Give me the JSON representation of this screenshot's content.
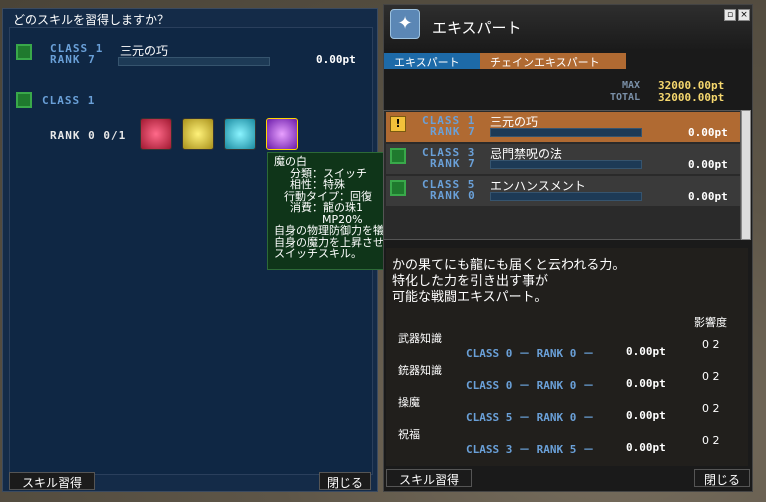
{
  "left": {
    "title": "どのスキルを習得しますか？",
    "top_row": {
      "class": "CLASS  1",
      "rank": "RANK  7",
      "skill": "三元の巧",
      "points": "0.00pt"
    },
    "class_header": "CLASS  1",
    "rank_line": "RANK  0  0/1",
    "buttons": {
      "learn": "スキル習得",
      "close": "閉じる"
    }
  },
  "tooltip": {
    "lines": [
      "魔の白",
      "分類：スイッチ",
      "相性：特殊",
      "行動タイプ：回復",
      "消費：龍の珠1",
      "MP20%",
      "自身の物理防御力を犠牲にして、",
      "自身の魔力を上昇させる",
      "スイッチスキル。"
    ]
  },
  "right": {
    "title": "エキスパート",
    "tabs": [
      "エキスパート",
      "チェインエキスパート"
    ],
    "max_label": "MAX",
    "max_value": "32000.00pt",
    "total_label": "TOTAL",
    "total_value": "32000.00pt",
    "list": [
      {
        "class": "CLASS  1",
        "rank": "RANK  7",
        "name": "三元の巧",
        "points": "0.00pt"
      },
      {
        "class": "CLASS  3",
        "rank": "RANK  7",
        "name": "忌門禁呪の法",
        "points": "0.00pt"
      },
      {
        "class": "CLASS  5",
        "rank": "RANK  0",
        "name": "エンハンスメント",
        "points": "0.00pt"
      }
    ],
    "description": [
      "かの果てにも龍にも届くと云われる力。",
      "特化した力を引き出す事が",
      "可能な戦闘エキスパート。"
    ],
    "influence_header": "影響度",
    "influences": [
      {
        "label": "武器知識",
        "class": "CLASS 0 － RANK 0 －",
        "points": "0.00pt",
        "value": "0 2"
      },
      {
        "label": "銃器知識",
        "class": "CLASS 0 － RANK 0 －",
        "points": "0.00pt",
        "value": "0 2"
      },
      {
        "label": "操魔",
        "class": "CLASS 5 － RANK 0 －",
        "points": "0.00pt",
        "value": "0 2"
      },
      {
        "label": "祝福",
        "class": "CLASS 3 － RANK 5 －",
        "points": "0.00pt",
        "value": "0 2"
      }
    ],
    "buttons": {
      "learn": "スキル習得",
      "close": "閉じる"
    }
  },
  "colors": {
    "accent_orange": "#b06a32",
    "class_blue": "#6aa0d8",
    "total_yellow": "#f5d76e"
  }
}
